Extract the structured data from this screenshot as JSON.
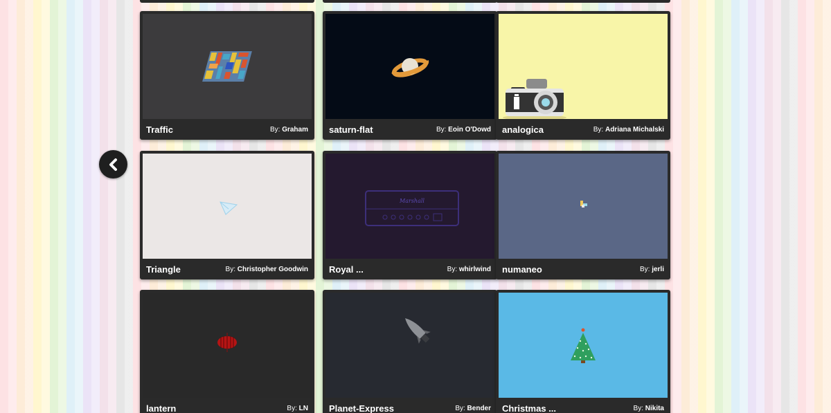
{
  "by_label": "By:",
  "nav": {
    "back_icon": "chevron-left-icon"
  },
  "cards": [
    {
      "title": "Traffic",
      "author": "Graham",
      "thumb_bg": "#3c3b3d",
      "icon": "traffic-blocks-icon"
    },
    {
      "title": "saturn-flat",
      "author": "Eoin O'Dowd",
      "thumb_bg": "#040b16",
      "icon": "saturn-planet-icon"
    },
    {
      "title": "analogica",
      "author": "Adriana Michalski",
      "thumb_bg": "#f8f5a8",
      "icon": "camera-icon"
    },
    {
      "title": "Triangle",
      "author": "Christopher Goodwin",
      "thumb_bg": "#ebe7e6",
      "icon": "paper-plane-icon"
    },
    {
      "title": "Royal ...",
      "author": "whirlwind",
      "thumb_bg": "#24192f",
      "icon": "amplifier-icon",
      "amp_label": "Marshall"
    },
    {
      "title": "numaneo",
      "author": "jerli",
      "thumb_bg": "#5a6786",
      "icon": "tiny-shape-icon"
    },
    {
      "title": "lantern",
      "author": "LN",
      "thumb_bg": "#292929",
      "icon": "lantern-icon"
    },
    {
      "title": "Planet-Express",
      "author": "Bender",
      "thumb_bg": "#272a31",
      "icon": "rocket-icon"
    },
    {
      "title": "Christmas ...",
      "author": "Nikita",
      "thumb_bg": "#5ab9e6",
      "icon": "christmas-tree-icon"
    }
  ]
}
